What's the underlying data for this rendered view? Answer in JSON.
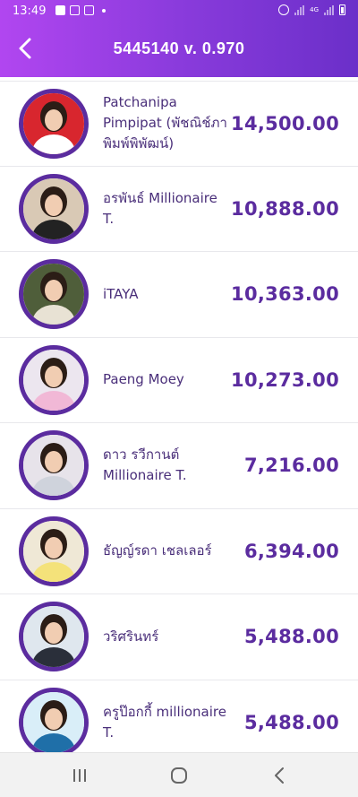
{
  "status_bar": {
    "time": "13:49",
    "lte_label": "4G",
    "icons": [
      "facebook-icon",
      "mail-icon",
      "gallery-icon",
      "alarm-icon",
      "signal-icon",
      "battery-icon"
    ]
  },
  "header": {
    "title": "5445140 v. 0.970",
    "gradient": [
      "#b146f0",
      "#6b2fc9"
    ]
  },
  "colors": {
    "accent": "#5b2c9f",
    "name_text": "#4a2f7a",
    "divider": "#e8e8ec"
  },
  "list": [
    {
      "name": "Patchanipa Pimpipat (พัชณิช์ภา พิมพ์พิพัฒน์)",
      "amount": "14,500.00",
      "avatar_bg": "#d8262e",
      "avatar_shirt": "#ffffff"
    },
    {
      "name": "อรพันธ์ Millionaire T.",
      "amount": "10,888.00",
      "avatar_bg": "#d9c9b5",
      "avatar_shirt": "#222222"
    },
    {
      "name": "iTAYA",
      "amount": "10,363.00",
      "avatar_bg": "#4f5e3a",
      "avatar_shirt": "#e8e2d4"
    },
    {
      "name": "Paeng Moey",
      "amount": "10,273.00",
      "avatar_bg": "#ece6ef",
      "avatar_shirt": "#f1b8d6"
    },
    {
      "name": "ดาว รวีกานต์ Millionaire T.",
      "amount": "7,216.00",
      "avatar_bg": "#e7e3ea",
      "avatar_shirt": "#cfd3dc"
    },
    {
      "name": "ธัญญ์รดา เชลเลอร์",
      "amount": "6,394.00",
      "avatar_bg": "#efe8d6",
      "avatar_shirt": "#f4e27a"
    },
    {
      "name": "วริศรินทร์",
      "amount": "5,488.00",
      "avatar_bg": "#dfe7ee",
      "avatar_shirt": "#2a2f3a"
    },
    {
      "name": "ครูป๊อกกี้ millionaire T.",
      "amount": "5,488.00",
      "avatar_bg": "#d9eef8",
      "avatar_shirt": "#1f6fa8"
    }
  ],
  "navbar": {
    "icons": [
      "recent-apps-icon",
      "home-icon",
      "back-nav-icon"
    ]
  }
}
